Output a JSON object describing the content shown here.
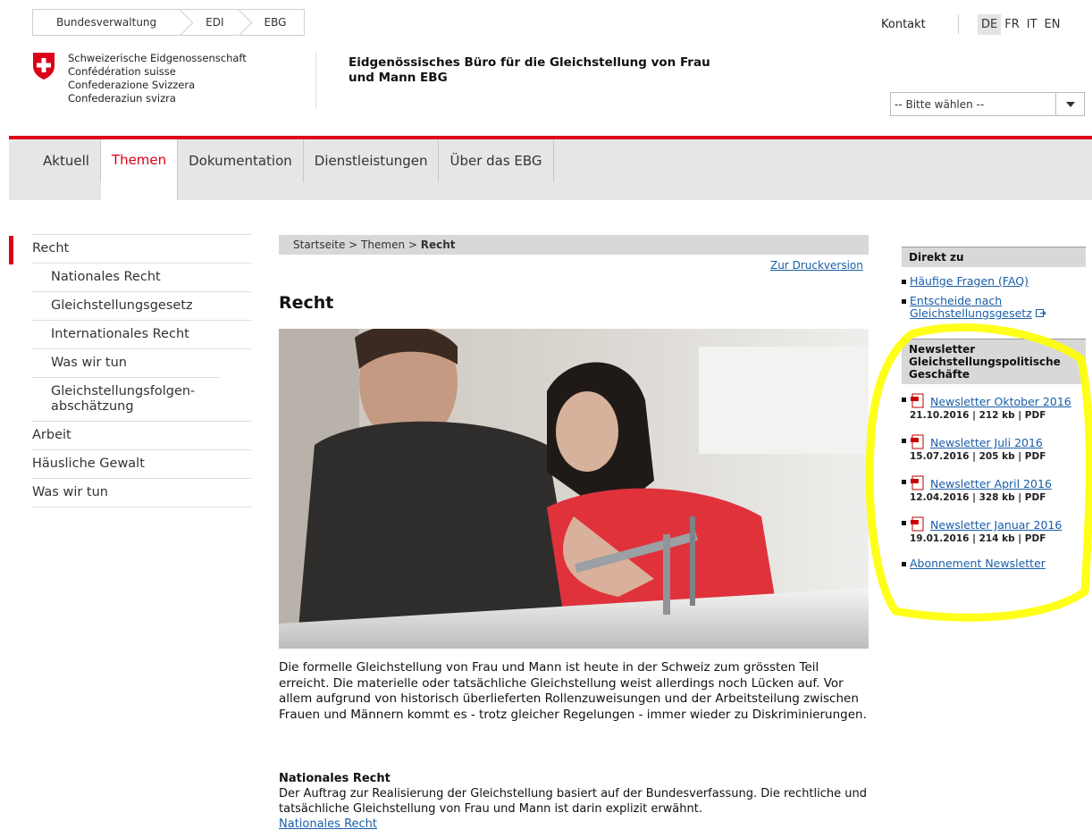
{
  "top": {
    "crumbs": [
      "Bundesverwaltung",
      "EDI",
      "EBG"
    ],
    "kontakt": "Kontakt",
    "languages": [
      "DE",
      "FR",
      "IT",
      "EN"
    ],
    "active_language": "DE"
  },
  "logo": {
    "lines": [
      "Schweizerische Eidgenossenschaft",
      "Confédération suisse",
      "Confederazione Svizzera",
      "Confederaziun svizra"
    ]
  },
  "office_title": "Eidgenössisches Büro für die Gleichstellung von Frau und Mann EBG",
  "select": {
    "value": "-- Bitte wählen --"
  },
  "nav": [
    "Aktuell",
    "Themen",
    "Dokumentation",
    "Dienstleistungen",
    "Über das EBG"
  ],
  "subnav": [
    {
      "label": "Recht",
      "level": 0
    },
    {
      "label": "Nationales Recht",
      "level": 1
    },
    {
      "label": "Gleichstellungsgesetz",
      "level": 1
    },
    {
      "label": "Internationales Recht",
      "level": 1
    },
    {
      "label": "Was wir tun",
      "level": 1
    },
    {
      "label": "Gleichstellungsfolgen-abschätzung",
      "level": 1
    },
    {
      "label": "Arbeit",
      "level": 0
    },
    {
      "label": "Häusliche Gewalt",
      "level": 0
    },
    {
      "label": "Was wir tun",
      "level": 0
    }
  ],
  "breadcrumb": {
    "path": "Startseite > Themen > ",
    "current": "Recht"
  },
  "print_link": "Zur Druckversion",
  "page_title": "Recht",
  "intro": "Die formelle Gleichstellung von Frau und Mann ist heute in der Schweiz zum grössten Teil erreicht. Die materielle oder tatsächliche Gleichstellung weist allerdings noch Lücken auf. Vor allem aufgrund von historisch überlieferten Rollenzuweisungen und der Arbeitsteilung zwischen Frauen und Männern kommt es - trotz gleicher Regelungen - immer wieder zu Diskriminierungen.",
  "section": {
    "heading": "Nationales Recht",
    "text": "Der Auftrag zur Realisierung der Gleichstellung basiert auf der Bundesverfassung. Die rechtliche und tatsächliche Gleichstellung von Frau und Mann ist darin explizit erwähnt.",
    "link": "Nationales Recht"
  },
  "right": {
    "direkt_heading": "Direkt zu",
    "direkt_links": [
      "Häufige Fragen (FAQ)",
      "Entscheide nach Gleichstellungsgesetz"
    ],
    "newsletter_heading": "Newsletter Gleichstellungspolitische Geschäfte",
    "newsletters": [
      {
        "title": "Newsletter Oktober 2016",
        "meta": "21.10.2016 | 212 kb | PDF"
      },
      {
        "title": "Newsletter Juli 2016",
        "meta": "15.07.2016 | 205 kb | PDF"
      },
      {
        "title": "Newsletter April 2016",
        "meta": "12.04.2016 | 328 kb | PDF"
      },
      {
        "title": "Newsletter Januar 2016",
        "meta": "19.01.2016 | 214 kb | PDF"
      }
    ],
    "abo": "Abonnement Newsletter"
  },
  "colors": {
    "accent_red": "#dc0018",
    "link_blue": "#1a5ea8",
    "highlight_yellow": "#ffff00"
  }
}
